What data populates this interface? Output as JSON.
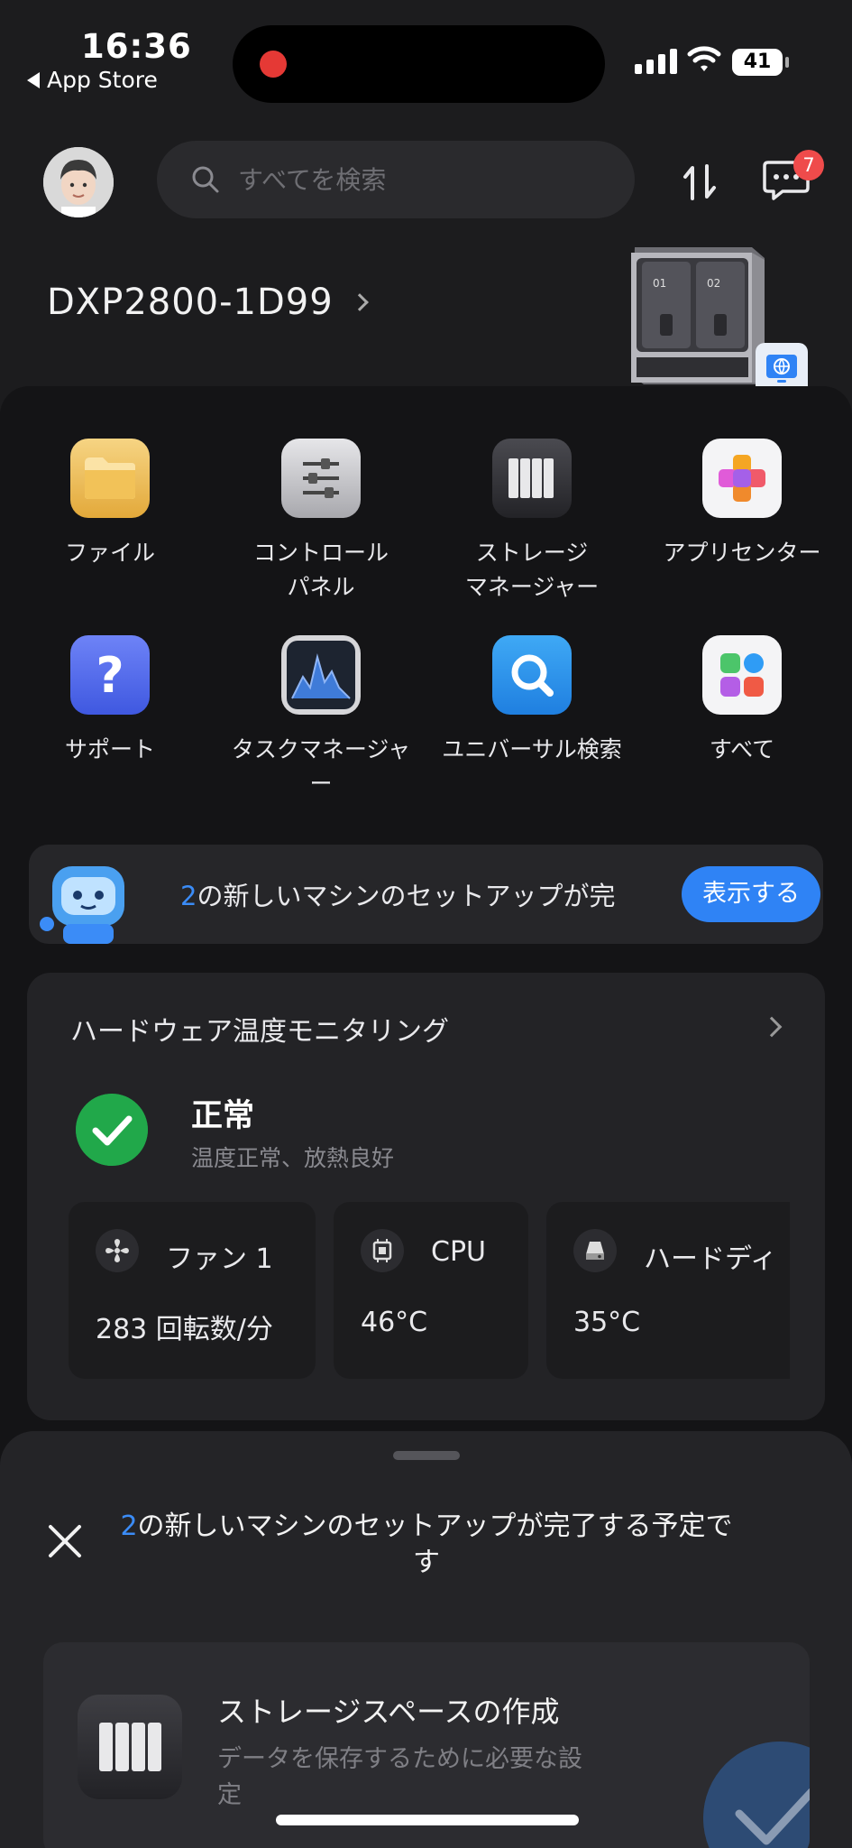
{
  "status_bar": {
    "time": "16:36",
    "back_label": "App Store",
    "battery": "41"
  },
  "top_bar": {
    "search_placeholder": "すべてを検索",
    "notification_count": "7"
  },
  "device": {
    "name": "DXP2800-1D99"
  },
  "apps": [
    {
      "label": "ファイル",
      "icon": "folder-icon"
    },
    {
      "label": "コントロール\nパネル",
      "icon": "sliders-icon"
    },
    {
      "label": "ストレージ\nマネージャー",
      "icon": "storage-icon"
    },
    {
      "label": "アプリセンター",
      "icon": "app-center-icon"
    },
    {
      "label": "サポート",
      "icon": "question-icon"
    },
    {
      "label": "タスクマネージャ\nー",
      "icon": "task-monitor-icon"
    },
    {
      "label": "ユニバーサル検索",
      "icon": "search-icon"
    },
    {
      "label": "すべて",
      "icon": "all-apps-icon"
    }
  ],
  "banner": {
    "number": "2",
    "text": "の新しいマシンのセットアップが完",
    "button": "表示する"
  },
  "hardware": {
    "title": "ハードウェア温度モニタリング",
    "status": "正常",
    "status_detail": "温度正常、放熱良好",
    "sensors": [
      {
        "name": "ファン 1",
        "value": "283 回転数/分",
        "icon": "fan-icon"
      },
      {
        "name": "CPU",
        "value": "46°C",
        "icon": "cpu-icon"
      },
      {
        "name": "ハードディ",
        "value": "35°C",
        "icon": "disk-icon"
      }
    ]
  },
  "sheet": {
    "title_number": "2",
    "title_text": "の新しいマシンのセットアップが完了する予定です",
    "task_title": "ストレージスペースの作成",
    "task_sub": "データを保存するために必要な設定"
  },
  "colors": {
    "accent": "#2f83f5",
    "success": "#21a84a",
    "badge": "#ef4b4b",
    "background": "#141416"
  }
}
